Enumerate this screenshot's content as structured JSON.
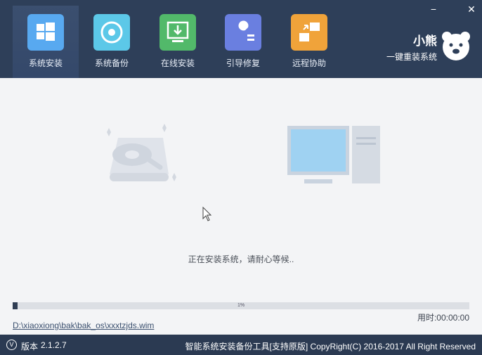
{
  "tabs": [
    {
      "label": "系统安装",
      "icon": "windows-icon",
      "color": "#58a9f0"
    },
    {
      "label": "系统备份",
      "icon": "backup-icon",
      "color": "#5cc8e8"
    },
    {
      "label": "在线安装",
      "icon": "download-icon",
      "color": "#52b96a"
    },
    {
      "label": "引导修复",
      "icon": "wrench-icon",
      "color": "#6a7fe0"
    },
    {
      "label": "远程协助",
      "icon": "remote-icon",
      "color": "#f0a33a"
    }
  ],
  "window": {
    "minimize": "−",
    "close": "✕"
  },
  "brand": {
    "name": "小熊",
    "slogan": "一键重装系统"
  },
  "main": {
    "status": "正在安装系统，请耐心等候..",
    "progress_label": "1%",
    "progress_value": 0.01,
    "elapsed": "用时:00:00:00",
    "path": "D:\\xiaoxiong\\bak\\bak_os\\xxxtzjds.wim"
  },
  "footer": {
    "version_icon": "V",
    "version_label": "版本",
    "version": "2.1.2.7",
    "copyright": "智能系统安装备份工具[支持原版]  CopyRight(C) 2016-2017 All Right Reserved"
  },
  "colors": {
    "header": "#2e3f59",
    "main_bg": "#f3f4f6",
    "progress_fill": "#2f3d53"
  }
}
